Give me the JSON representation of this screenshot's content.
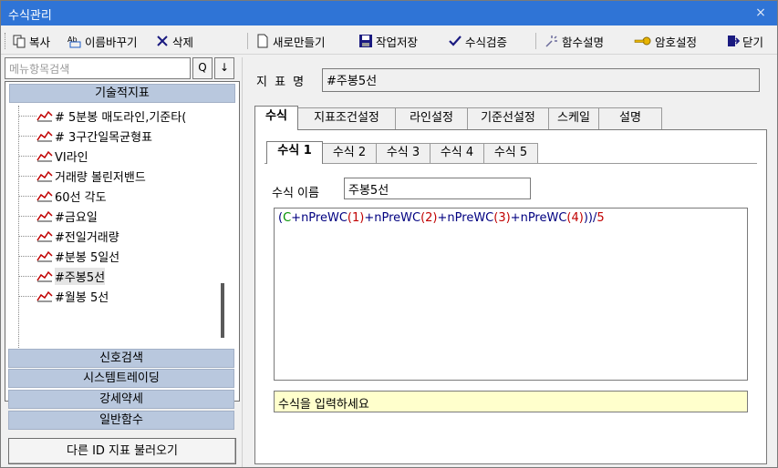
{
  "window": {
    "title": "수식관리",
    "close_label": "×"
  },
  "toolbar": {
    "copy": "복사",
    "rename": "이름바꾸기",
    "delete": "삭제",
    "new": "새로만들기",
    "save": "작업저장",
    "verify": "수식검증",
    "func_help": "함수설명",
    "password": "암호설정",
    "close": "닫기"
  },
  "left": {
    "search_placeholder": "메뉴항목검색",
    "search_btn": "Q",
    "down_btn": "↓",
    "category_top": "기술적지표",
    "items": [
      {
        "label": "# 5분봉 매도라인,기준타("
      },
      {
        "label": "# 3구간일목균형표"
      },
      {
        "label": "VI라인"
      },
      {
        "label": "거래량 볼린저밴드"
      },
      {
        "label": "60선 각도"
      },
      {
        "label": "#금요일"
      },
      {
        "label": "#전일거래량"
      },
      {
        "label": "#분봉 5일선"
      },
      {
        "label": "#주봉5선",
        "selected": true
      },
      {
        "label": "#월봉 5선"
      }
    ],
    "categories_bottom": [
      "신호검색",
      "시스템트레이딩",
      "강세약세",
      "일반함수"
    ],
    "load_button": "다른 ID 지표 불러오기"
  },
  "right": {
    "name_label": "지 표 명",
    "name_value": "#주봉5선",
    "tabs": [
      "수식",
      "지표조건설정",
      "라인설정",
      "기준선설정",
      "스케일",
      "설명"
    ],
    "active_tab": "수식",
    "subtabs": [
      "수식 1",
      "수식 2",
      "수식 3",
      "수식 4",
      "수식 5"
    ],
    "active_subtab": "수식 1",
    "formula_name_label": "수식 이름",
    "formula_name_value": "주봉5선",
    "formula": {
      "open": "(",
      "c": "C",
      "p1": "+",
      "f1": "nPreWC",
      "a1": "(1)",
      "p2": "+",
      "f2": "nPreWC",
      "a2": "(2)",
      "p3": "+",
      "f3": "nPreWC",
      "a3": "(3)",
      "p4": "+",
      "f4": "nPreWC",
      "a4": "(4)",
      "close": "))",
      "div": "/",
      "n5": "5"
    },
    "status_text": "수식을 입력하세요"
  },
  "colors": {
    "titlebar": "#2f74d6",
    "category_bg": "#b9c8de",
    "status_bg": "#ffffcc",
    "formula_red": "#c00000",
    "formula_green": "#009000"
  }
}
